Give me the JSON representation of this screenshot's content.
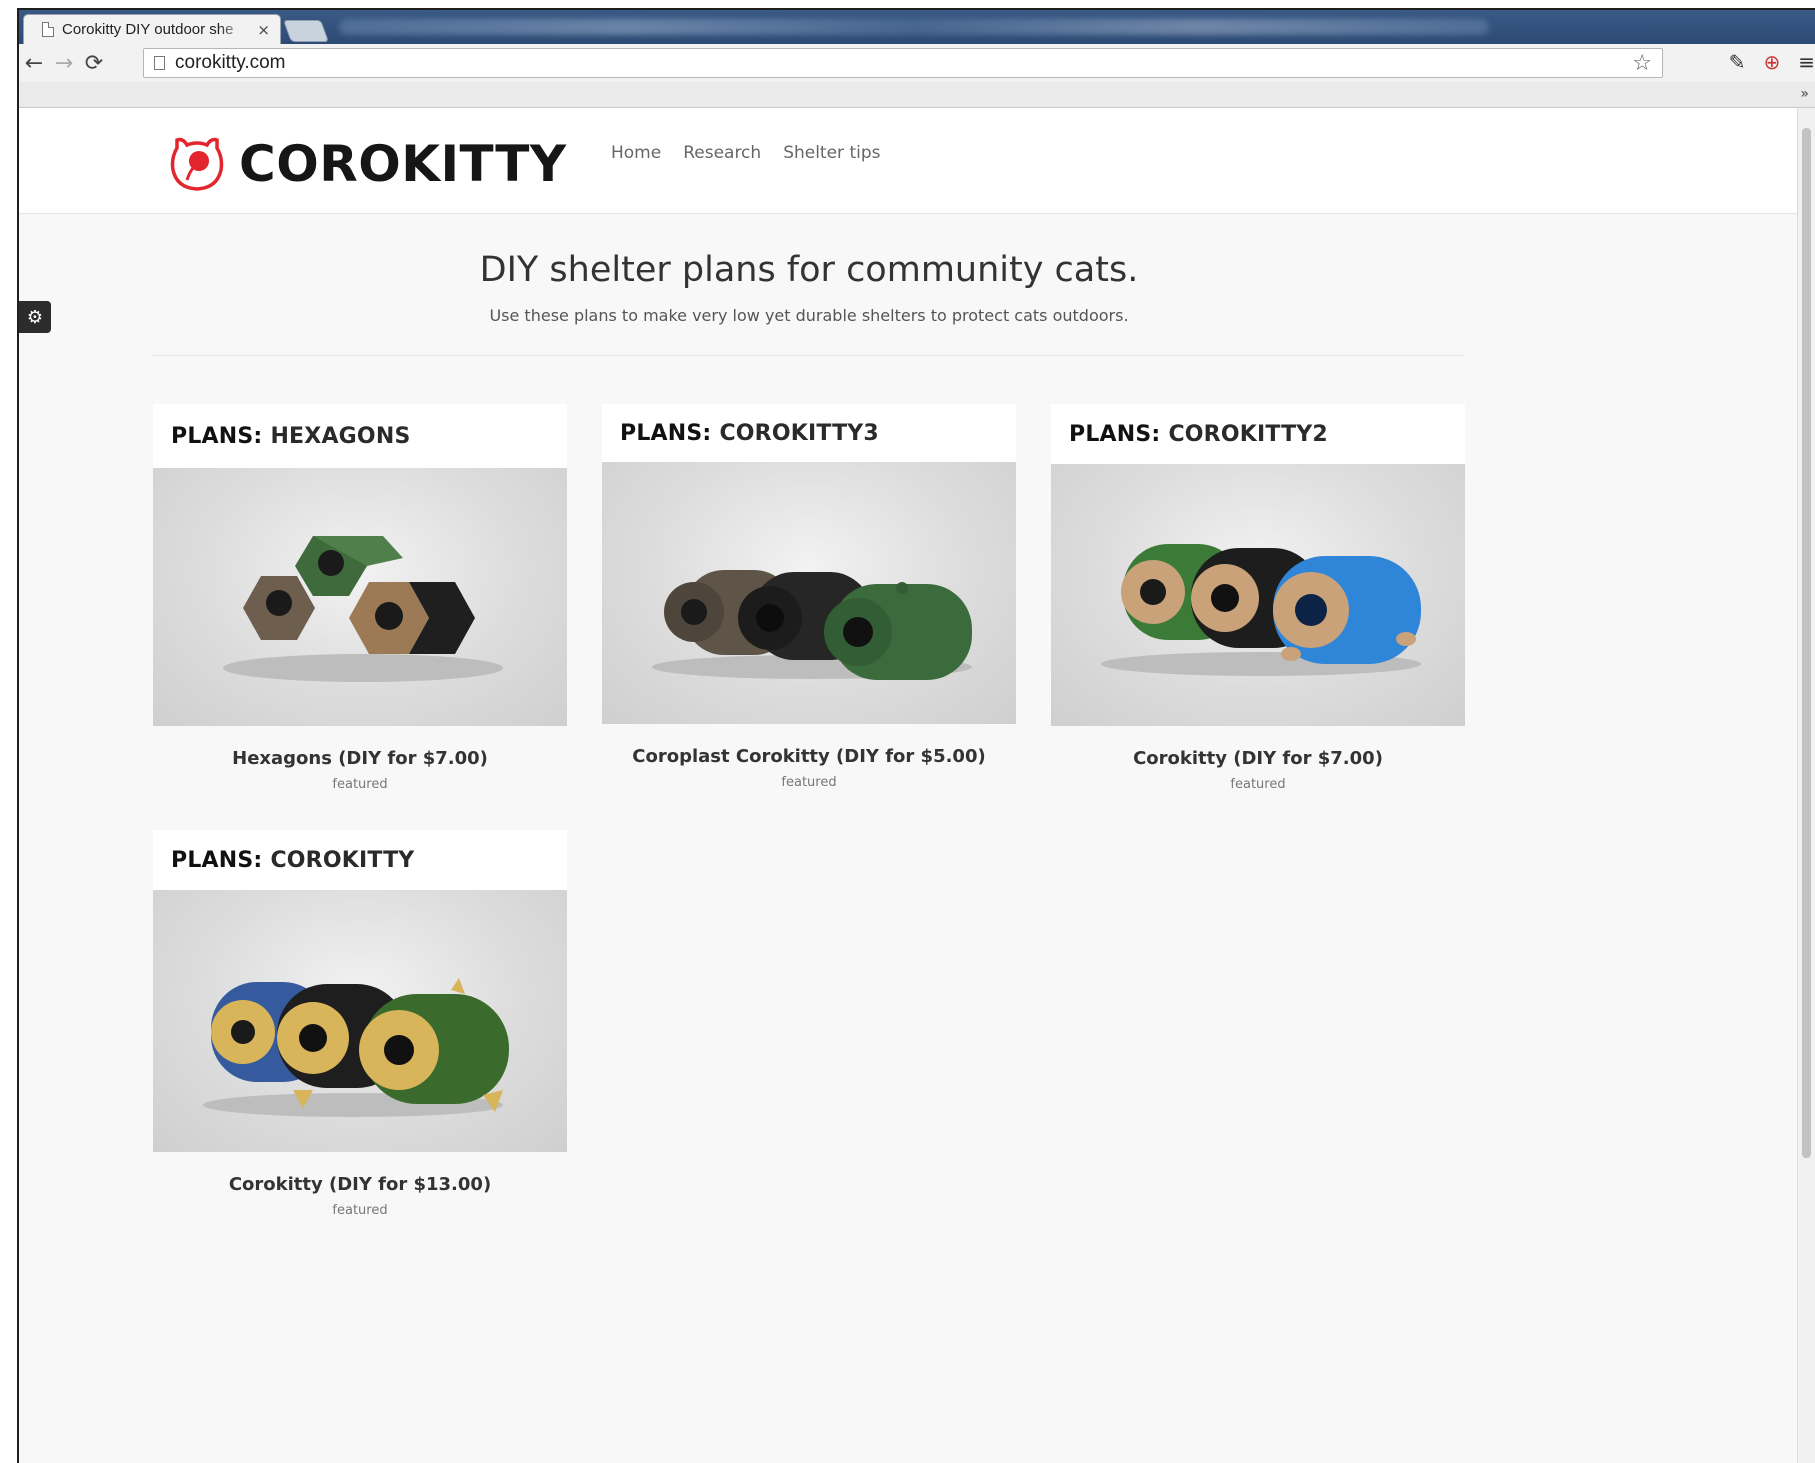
{
  "browser": {
    "tab_title": "Corokitty DIY outdoor she",
    "tab_close": "×",
    "url": "corokitty.com",
    "bookmarks_chevron": "»"
  },
  "site": {
    "logo_text": "COROKITTY",
    "nav": [
      "Home",
      "Research",
      "Shelter tips"
    ],
    "settings_icon": "⚙"
  },
  "hero": {
    "title": "DIY shelter plans for community cats.",
    "subtitle": "Use these plans to make very low yet durable shelters to protect cats outdoors."
  },
  "products": [
    {
      "plan_prefix": "PLANS:",
      "plan_name": "HEXAGONS",
      "caption": "Hexagons (DIY for $7.00)",
      "tag": "featured",
      "colors": [
        "#6d5e4e",
        "#3f6b3c",
        "#1f1f1f"
      ]
    },
    {
      "plan_prefix": "PLANS:",
      "plan_name": "COROKITTY3",
      "caption": "Coroplast Corokitty (DIY for $5.00)",
      "tag": "featured",
      "colors": [
        "#5e5548",
        "#262626",
        "#3b6b3c"
      ]
    },
    {
      "plan_prefix": "PLANS:",
      "plan_name": "COROKITTY2",
      "caption": "Corokitty (DIY for $7.00)",
      "tag": "featured",
      "colors": [
        "#3b7a37",
        "#1d1d1d",
        "#2f86d8"
      ]
    },
    {
      "plan_prefix": "PLANS:",
      "plan_name": "COROKITTY",
      "caption": "Corokitty (DIY for $13.00)",
      "tag": "featured",
      "colors": [
        "#355a9e",
        "#1e1e1e",
        "#3a6a2c"
      ]
    }
  ],
  "colors": {
    "accent": "#e3262e",
    "text_dark": "#161616"
  }
}
